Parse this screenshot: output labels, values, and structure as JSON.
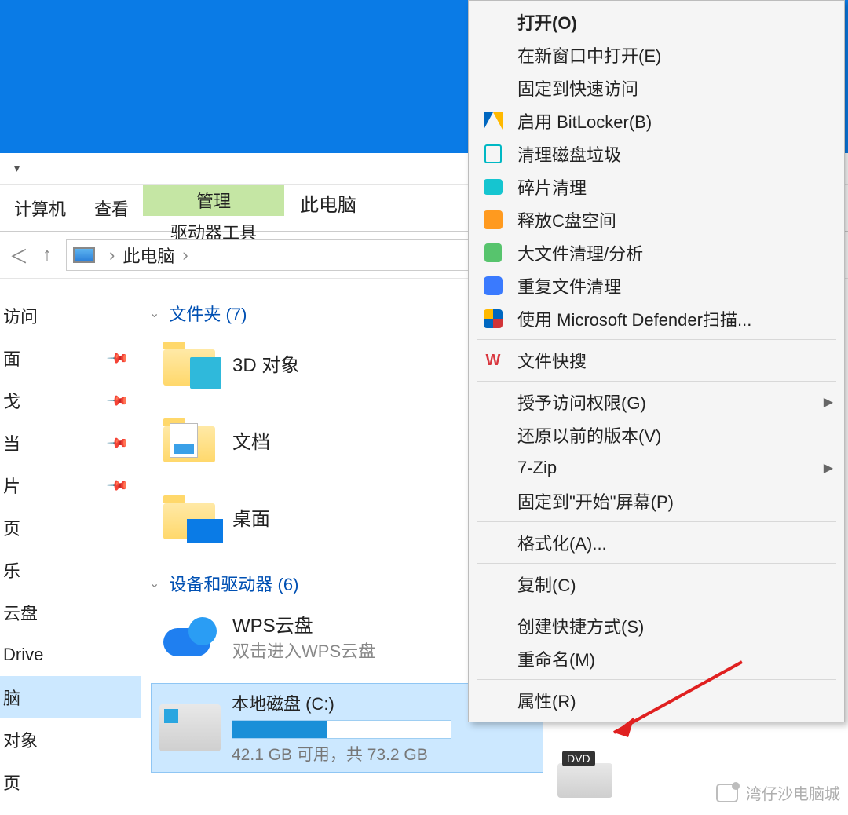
{
  "ribbon": {
    "computer_tab": "计算机",
    "view_tab": "查看",
    "manage_top": "管理",
    "manage_bottom": "驱动器工具",
    "pc_label": "此电脑"
  },
  "qat_glyph": "▾",
  "nav": {
    "back_glyph": "＜",
    "up_glyph": "↑",
    "crumb_sep": "›",
    "breadcrumb": "此电脑"
  },
  "sidebar": {
    "items": [
      {
        "label": "访问",
        "pinned": false
      },
      {
        "label": "面",
        "pinned": true
      },
      {
        "label": "戈",
        "pinned": true
      },
      {
        "label": "当",
        "pinned": true
      },
      {
        "label": "片",
        "pinned": true
      },
      {
        "label": "页",
        "pinned": false
      },
      {
        "label": "乐",
        "pinned": false
      },
      {
        "label": "云盘",
        "pinned": false
      },
      {
        "label": "Drive",
        "pinned": false
      },
      {
        "label": "脑",
        "pinned": false,
        "selected": true
      },
      {
        "label": "对象",
        "pinned": false
      },
      {
        "label": "页",
        "pinned": false
      }
    ],
    "pin_glyph": "📌"
  },
  "content": {
    "folders_header": "文件夹 (7)",
    "folders": [
      {
        "label": "3D 对象",
        "variant": "3d"
      },
      {
        "label": "文档",
        "variant": "doc"
      },
      {
        "label": "桌面",
        "variant": "desk"
      }
    ],
    "devices_header": "设备和驱动器 (6)",
    "wps": {
      "title": "WPS云盘",
      "subtitle": "双击进入WPS云盘"
    },
    "drive": {
      "name": "本地磁盘 (C:)",
      "stats": "42.1 GB 可用，共 73.2 GB",
      "fill_percent": 43
    },
    "dvd_label": "DVD"
  },
  "context_menu": {
    "groups": [
      [
        {
          "label": "打开(O)",
          "bold": true
        },
        {
          "label": "在新窗口中打开(E)"
        },
        {
          "label": "固定到快速访问"
        },
        {
          "label": "启用 BitLocker(B)",
          "icon": "shield"
        },
        {
          "label": "清理磁盘垃圾",
          "icon": "trash"
        },
        {
          "label": "碎片清理",
          "icon": "sq-teal"
        },
        {
          "label": "释放C盘空间",
          "icon": "sq-orange"
        },
        {
          "label": "大文件清理/分析",
          "icon": "broom"
        },
        {
          "label": "重复文件清理",
          "icon": "sq-blue"
        },
        {
          "label": "使用 Microsoft Defender扫描...",
          "icon": "defend"
        }
      ],
      [
        {
          "label": "文件快搜",
          "icon": "wps"
        }
      ],
      [
        {
          "label": "授予访问权限(G)",
          "submenu": true
        },
        {
          "label": "还原以前的版本(V)"
        },
        {
          "label": "7-Zip",
          "submenu": true
        },
        {
          "label": "固定到\"开始\"屏幕(P)"
        }
      ],
      [
        {
          "label": "格式化(A)..."
        }
      ],
      [
        {
          "label": "复制(C)"
        }
      ],
      [
        {
          "label": "创建快捷方式(S)"
        },
        {
          "label": "重命名(M)"
        }
      ],
      [
        {
          "label": "属性(R)"
        }
      ]
    ],
    "submenu_glyph": "▶"
  },
  "watermark": "湾仔沙电脑城",
  "chevron_glyph": "⌄"
}
